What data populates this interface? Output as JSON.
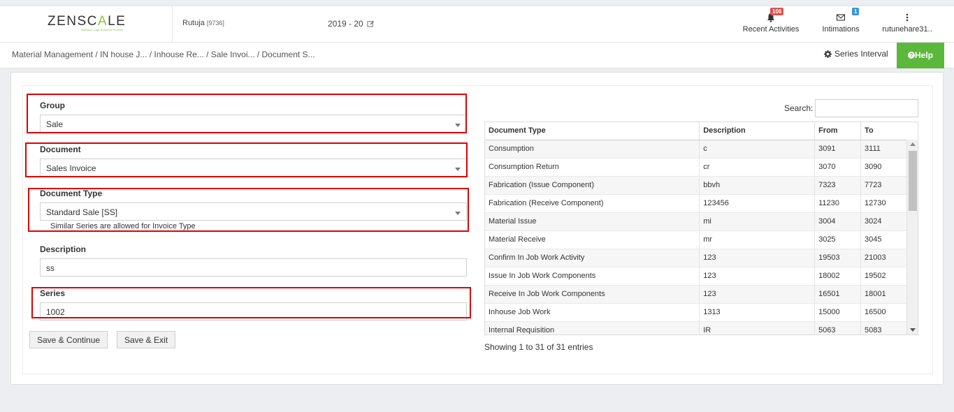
{
  "header": {
    "logo_left": "ZENSC",
    "logo_accent": "A",
    "logo_right": "LE",
    "logo_tagline": "Business Logic Business Process",
    "user_name": "Rutuja",
    "user_id": "[9736]",
    "fiscal_year": "2019 - 20",
    "recent_activities_label": "Recent Activities",
    "recent_activities_badge": "106",
    "intimations_label": "Intimations",
    "intimations_badge": "1",
    "account_label": "rutunehare31.."
  },
  "breadcrumb": {
    "text": "Material Management  / IN house J... / Inhouse Re... / Sale Invoi... / Document S..."
  },
  "actions": {
    "series_interval": "Series Interval",
    "help": "Help"
  },
  "form": {
    "group_label": "Group",
    "group_value": "Sale",
    "document_label": "Document",
    "document_value": "Sales Invoice",
    "document_type_label": "Document Type",
    "document_type_value": "Standard Sale [SS]",
    "document_type_hint": "Similar Series are allowed for Invoice Type",
    "description_label": "Description",
    "description_value": "ss",
    "series_label": "Series",
    "series_value": "1002",
    "save_continue": "Save & Continue",
    "save_exit": "Save & Exit"
  },
  "table": {
    "search_label": "Search:",
    "columns": [
      "Document Type",
      "Description",
      "From",
      "To"
    ],
    "rows": [
      [
        "Consumption",
        "c",
        "3091",
        "3111"
      ],
      [
        "Consumption Return",
        "cr",
        "3070",
        "3090"
      ],
      [
        "Fabrication (Issue Component)",
        "bbvh",
        "7323",
        "7723"
      ],
      [
        "Fabrication (Receive Component)",
        "123456",
        "11230",
        "12730"
      ],
      [
        "Material Issue",
        "mi",
        "3004",
        "3024"
      ],
      [
        "Material Receive",
        "mr",
        "3025",
        "3045"
      ],
      [
        "Confirm In Job Work Activity",
        "123",
        "19503",
        "21003"
      ],
      [
        "Issue In Job Work Components",
        "123",
        "18002",
        "19502"
      ],
      [
        "Receive In Job Work Components",
        "123",
        "16501",
        "18001"
      ],
      [
        "Inhouse Job Work",
        "1313",
        "15000",
        "16500"
      ],
      [
        "Internal Requisition",
        "IR",
        "5063",
        "5083"
      ]
    ],
    "footer": "Showing 1 to 31 of 31 entries"
  },
  "colors": {
    "accent_green": "#8dc63f",
    "help_green": "#5cb83c",
    "highlight_red": "#e00000",
    "badge_red": "#d9534f",
    "badge_blue": "#3498db"
  }
}
